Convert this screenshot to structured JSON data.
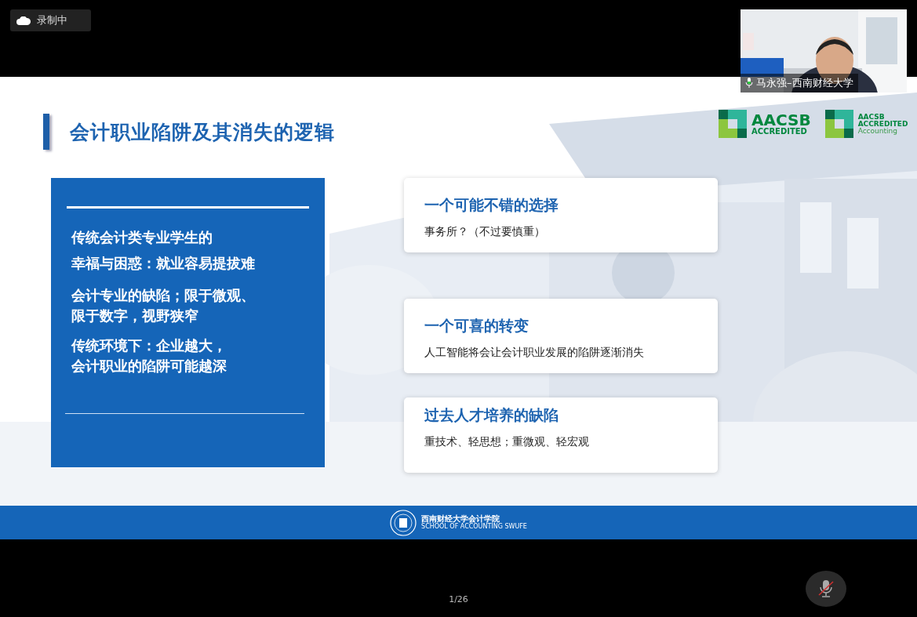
{
  "recording": {
    "label": "录制中"
  },
  "video_tile": {
    "name": "马永强–西南财经大学"
  },
  "slide": {
    "title": "会计职业陷阱及其消失的逻辑",
    "logos": [
      {
        "kind": "large",
        "lines": [
          "AACSB",
          "ACCREDITED"
        ]
      },
      {
        "kind": "small",
        "lines": [
          "AACSB",
          "ACCREDITED",
          "Accounting"
        ]
      }
    ],
    "left_panel": {
      "paragraphs": [
        [
          "传统会计类专业学生的",
          "幸福与困惑：就业容易提拔难"
        ],
        [
          "会计专业的缺陷；限于微观、",
          "限于数字，视野狭窄"
        ],
        [
          "传统环境下：企业越大，",
          "会计职业的陷阱可能越深"
        ]
      ]
    },
    "cards": [
      {
        "heading": "一个可能不错的选择",
        "body": "事务所？（不过要慎重）"
      },
      {
        "heading": "一个可喜的转变",
        "body": "人工智能将会让会计职业发展的陷阱逐渐消失"
      },
      {
        "heading": "过去人才培养的缺陷",
        "body": "重技术、轻思想；重微观、轻宏观"
      }
    ],
    "footer": {
      "name_cn": "西南财经大学会计学院",
      "name_en": "SCHOOL OF ACCOUNTING SWUFE"
    }
  },
  "page_indicator": "1/26",
  "mute_button": {
    "muted": true
  }
}
